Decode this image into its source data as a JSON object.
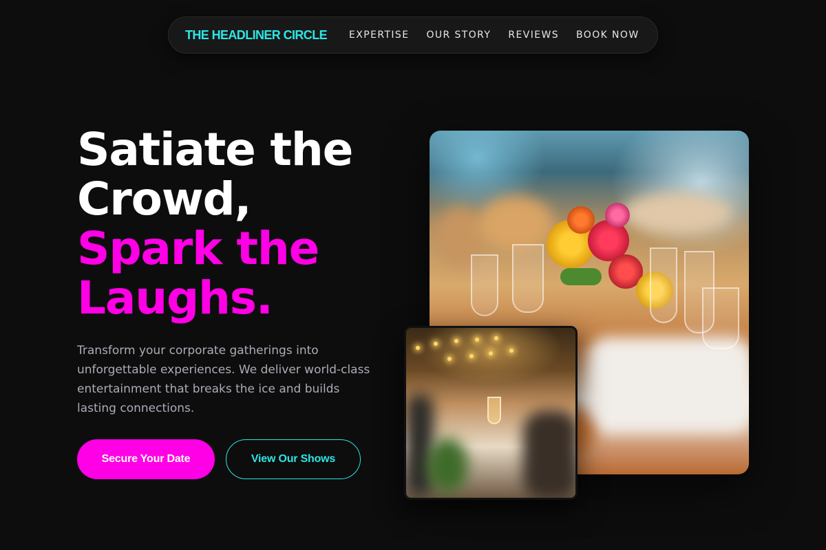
{
  "nav": {
    "brand": "THE HEADLINER CIRCLE",
    "links": [
      "EXPERTISE",
      "OUR STORY",
      "REVIEWS",
      "BOOK NOW"
    ]
  },
  "hero": {
    "headline_lines": [
      "Satiate the",
      "Crowd,"
    ],
    "highlight_lines": [
      "Spark the",
      "Laughs."
    ],
    "subtext": "Transform your corporate gatherings into unforgettable experiences. We deliver world-class entertainment that breaks the ice and builds lasting connections.",
    "primary_cta": "Secure Your Date",
    "secondary_cta": "View Our Shows"
  },
  "colors": {
    "background": "#0d0d0d",
    "accent_cyan": "#2ee6e6",
    "accent_magenta": "#ff00e6",
    "muted_text": "#a9adb5"
  }
}
